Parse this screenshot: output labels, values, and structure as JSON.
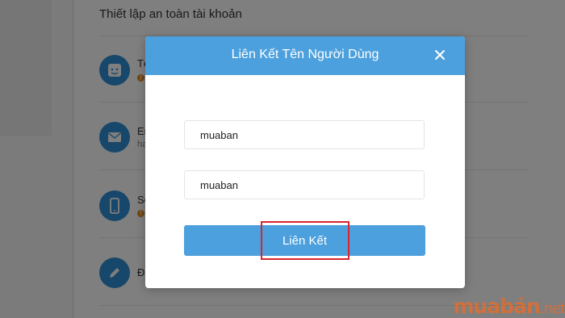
{
  "background": {
    "section_title": "Thiết lập an toàn tài khoản",
    "rows": [
      {
        "label_fragment": "Tê",
        "sub": "",
        "icon": "face-icon",
        "warning": true
      },
      {
        "label_fragment": "Em",
        "sub": "ha",
        "icon": "envelope-icon",
        "warning": false
      },
      {
        "label_fragment": "Sô",
        "sub": "",
        "icon": "phone-icon",
        "warning": true
      },
      {
        "label_fragment": "Đo",
        "sub": "",
        "icon": "pencil-icon",
        "warning": false
      }
    ],
    "warning_symbol": "!"
  },
  "modal": {
    "title": "Liên Kết Tên Người Dùng",
    "close_glyph": "✕",
    "field_1_value": "muaban",
    "field_2_value": "muaban",
    "submit_label": "Liên Kết"
  },
  "watermark": {
    "text": "muabán",
    "suffix": ".net"
  },
  "colors": {
    "accent": "#4ca0dd",
    "highlight": "#d8262e",
    "warning": "#e88a1a",
    "watermark": "#f26a22"
  }
}
